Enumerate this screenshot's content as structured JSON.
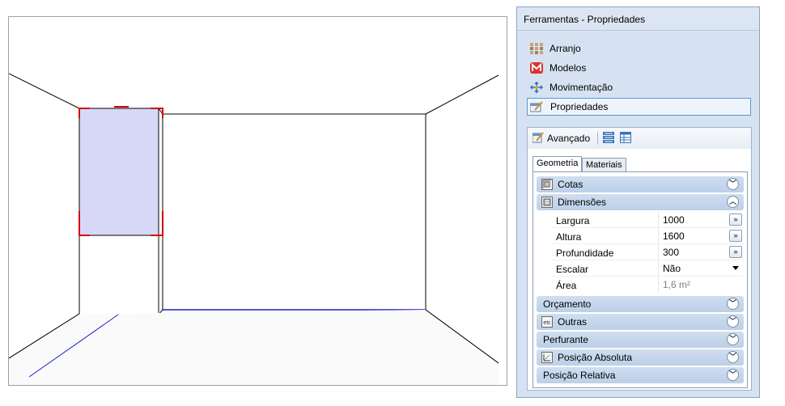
{
  "panel": {
    "title": "Ferramentas - Propriedades",
    "nav_items": [
      {
        "label": "Arranjo",
        "icon": "grid-icon"
      },
      {
        "label": "Modelos",
        "icon": "models-icon"
      },
      {
        "label": "Movimentação",
        "icon": "move-icon"
      },
      {
        "label": "Propriedades",
        "icon": "properties-icon",
        "selected": true
      }
    ],
    "toolbar": {
      "label": "Avançado"
    },
    "tabs": [
      {
        "label": "Geometria",
        "active": true
      },
      {
        "label": "Materiais",
        "active": false
      }
    ],
    "groups": {
      "cotas": {
        "label": "Cotas",
        "expanded": false
      },
      "dimensoes": {
        "label": "Dimensões",
        "expanded": true
      },
      "orcamento": {
        "label": "Orçamento",
        "expanded": false
      },
      "outras": {
        "label": "Outras",
        "expanded": false
      },
      "perfurante": {
        "label": "Perfurante",
        "expanded": false
      },
      "posicao_absoluta": {
        "label": "Posição Absoluta",
        "expanded": false
      },
      "posicao_relativa": {
        "label": "Posição Relativa",
        "expanded": false
      }
    },
    "properties": [
      {
        "label": "Largura",
        "value": "1000"
      },
      {
        "label": "Altura",
        "value": "1600"
      },
      {
        "label": "Profundidade",
        "value": "300"
      },
      {
        "label": "Escalar",
        "value": "Não"
      },
      {
        "label": "Área",
        "value": "1,6 m²"
      }
    ],
    "icons": {
      "outras": "etc"
    }
  },
  "colors": {
    "selection_fill": "#d7d8f8",
    "selection_handles": "#d40000",
    "floor_line": "#1a1acc"
  }
}
